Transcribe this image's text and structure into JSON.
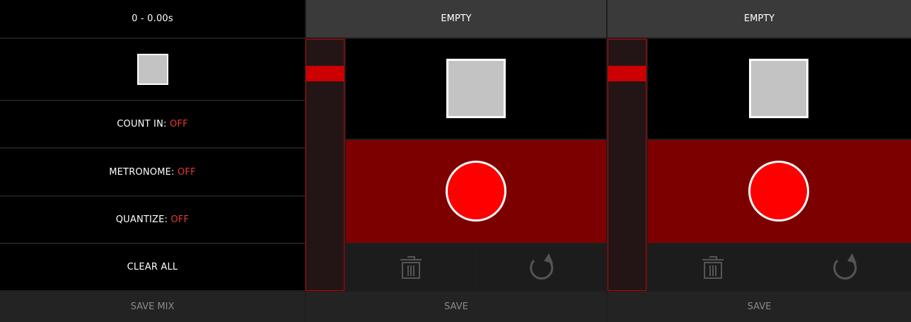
{
  "left_panel": {
    "time_display": "0 - 0.00s",
    "count_in": {
      "label": "COUNT IN:",
      "value": "OFF"
    },
    "metronome": {
      "label": "METRONOME:",
      "value": "OFF"
    },
    "quantize": {
      "label": "QUANTIZE:",
      "value": "OFF"
    },
    "clear_all": "CLEAR ALL",
    "save_mix": "SAVE MIX"
  },
  "tracks": [
    {
      "status": "EMPTY",
      "save_label": "SAVE"
    },
    {
      "status": "EMPTY",
      "save_label": "SAVE"
    }
  ],
  "colors": {
    "off_value": "#e53935",
    "record_zone": "#7d0000",
    "record_button": "#ff0000",
    "meter_peak": "#cc0000"
  }
}
